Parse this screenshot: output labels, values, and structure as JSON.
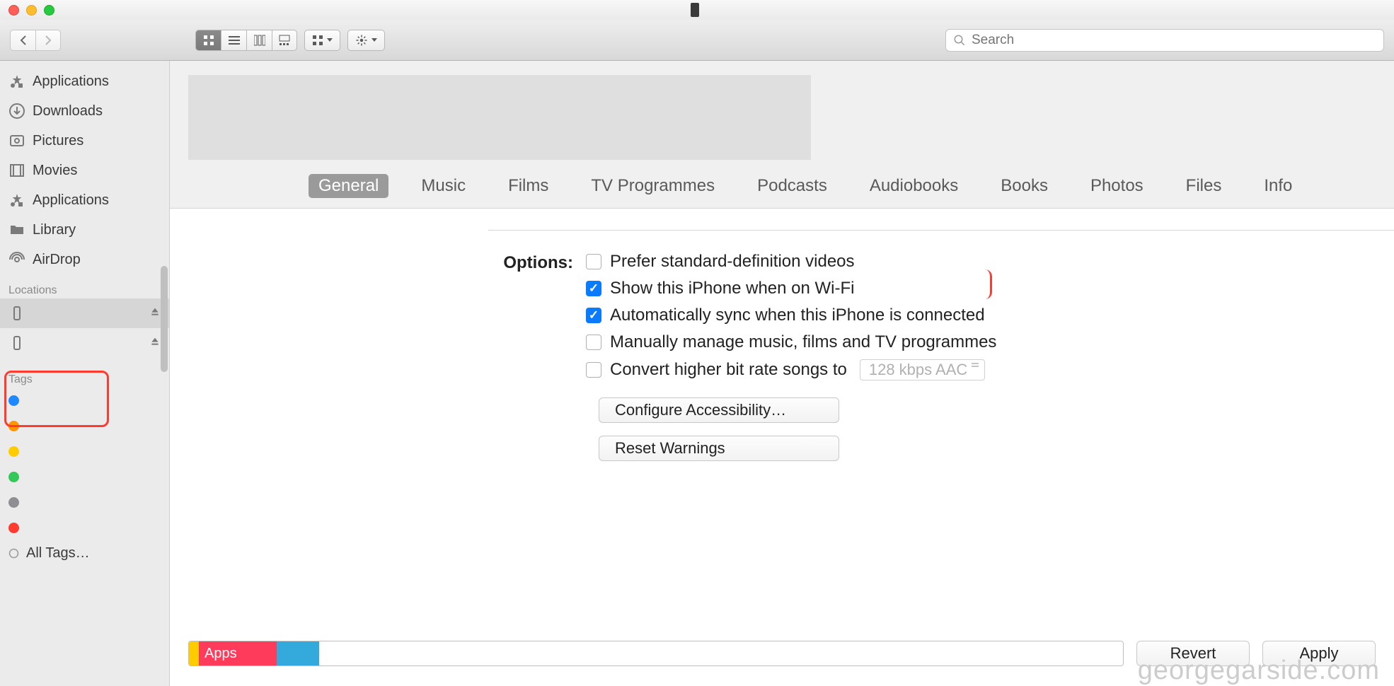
{
  "window": {
    "title": ""
  },
  "toolbar": {
    "search_placeholder": "Search"
  },
  "sidebar": {
    "favorites": [
      {
        "name": "applications-icon",
        "label": "Applications"
      },
      {
        "name": "downloads-icon",
        "label": "Downloads"
      },
      {
        "name": "pictures-icon",
        "label": "Pictures"
      },
      {
        "name": "movies-icon",
        "label": "Movies"
      },
      {
        "name": "applications-icon",
        "label": "Applications"
      },
      {
        "name": "folder-icon",
        "label": "Library"
      },
      {
        "name": "airdrop-icon",
        "label": "AirDrop"
      }
    ],
    "locations_header": "Locations",
    "locations": [
      {
        "label": "",
        "selected": true
      },
      {
        "label": "",
        "selected": false
      }
    ],
    "tags_header": "Tags",
    "tags": [
      {
        "color": "#1e88ff",
        "label": ""
      },
      {
        "color": "#ff9500",
        "label": ""
      },
      {
        "color": "#ffcc00",
        "label": ""
      },
      {
        "color": "#34c759",
        "label": ""
      },
      {
        "color": "#8e8e93",
        "label": ""
      },
      {
        "color": "#ff3b30",
        "label": ""
      }
    ],
    "all_tags": "All Tags…"
  },
  "tabs": {
    "items": [
      "General",
      "Music",
      "Films",
      "TV Programmes",
      "Podcasts",
      "Audiobooks",
      "Books",
      "Photos",
      "Files",
      "Info"
    ],
    "active": 0
  },
  "options": {
    "heading": "Options:",
    "items": [
      {
        "label": "Prefer standard-definition videos",
        "checked": false
      },
      {
        "label": "Show this iPhone when on Wi-Fi",
        "checked": true,
        "highlighted": true
      },
      {
        "label": "Automatically sync when this iPhone is connected",
        "checked": true
      },
      {
        "label": "Manually manage music, films and TV programmes",
        "checked": false
      },
      {
        "label": "Convert higher bit rate songs to",
        "checked": false,
        "bitrate": "128 kbps AAC"
      }
    ],
    "configure_btn": "Configure Accessibility…",
    "reset_btn": "Reset Warnings"
  },
  "storage": {
    "apps_label": "Apps"
  },
  "footer": {
    "revert": "Revert",
    "apply": "Apply"
  },
  "watermark": "georgegarside.com"
}
